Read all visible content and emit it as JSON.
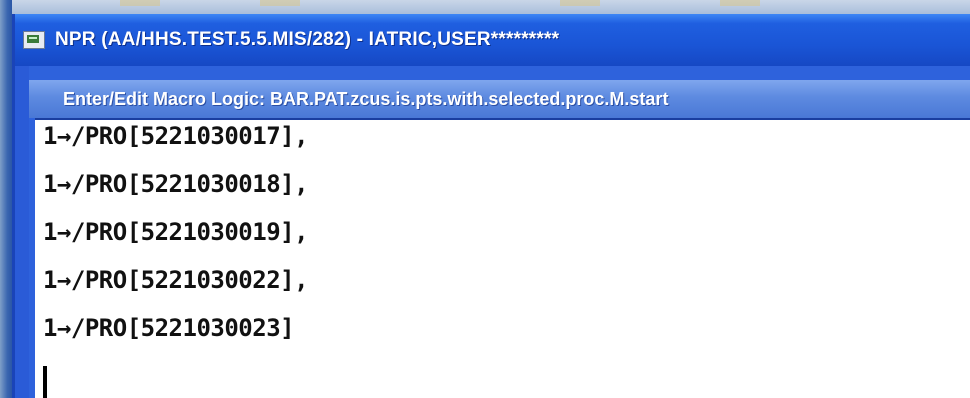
{
  "window": {
    "title": "NPR (AA/HHS.TEST.5.5.MIS/282) - IATRIC,USER*********"
  },
  "dialog": {
    "title": "Enter/Edit Macro Logic: BAR.PAT.zcus.is.pts.with.selected.proc.M.start"
  },
  "editor": {
    "lines": [
      "1→/PRO[5221030017],",
      "1→/PRO[5221030018],",
      "1→/PRO[5221030019],",
      "1→/PRO[5221030022],",
      "1→/PRO[5221030023]"
    ]
  },
  "colors": {
    "titlebar": "#1a55d6",
    "dialog_titlebar": "#5d8ae0",
    "editor_bg": "#ffffff",
    "text": "#111111"
  },
  "icons": {
    "app": "terminal-app-icon"
  }
}
